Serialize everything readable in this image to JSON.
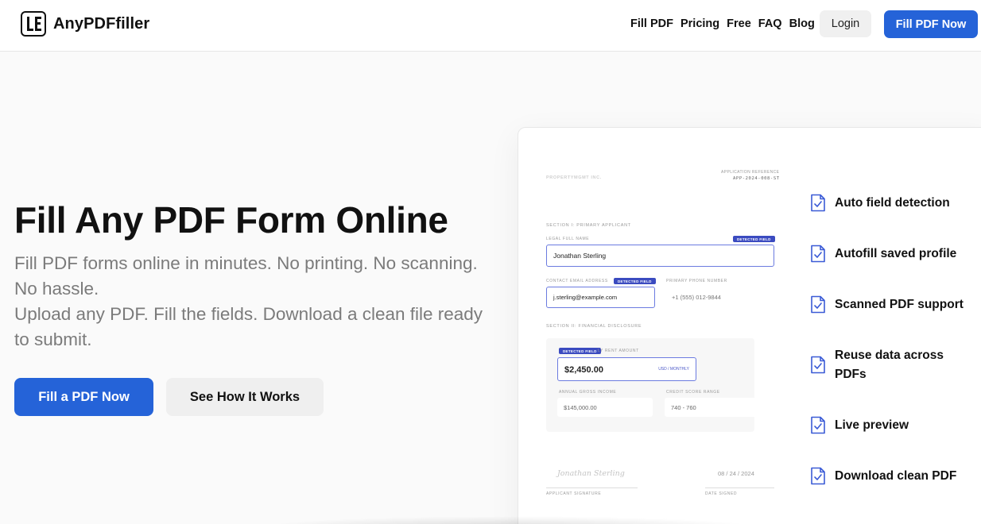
{
  "header": {
    "brand": "AnyPDFfiller",
    "nav": [
      "Fill PDF",
      "Pricing",
      "Free",
      "FAQ",
      "Blog"
    ],
    "login": "Login",
    "cta": "Fill PDF Now"
  },
  "hero": {
    "title": "Fill Any PDF Form Online",
    "subtitle_line1": "Fill PDF forms online in minutes. No printing. No scanning. No hassle.",
    "subtitle_line2": "Upload any PDF. Fill the fields. Download a clean file ready to submit.",
    "primary_button": "Fill a PDF Now",
    "secondary_button": "See How It Works"
  },
  "preview": {
    "brand": "PROPERTYMGMT INC.",
    "reference_label": "APPLICATION REFERENCE",
    "reference": "APP-2024-008-ST",
    "section1": "SECTION I: PRIMARY APPLICANT",
    "legal_name_label": "LEGAL FULL NAME",
    "detected_tag": "DETECTED FIELD",
    "legal_name": "Jonathan Sterling",
    "email_label": "CONTACT EMAIL ADDRESS",
    "email": "j.sterling@example.com",
    "phone_label": "PRIMARY PHONE NUMBER",
    "phone": "+1 (555) 012-9844",
    "section2": "SECTION II: FINANCIAL DISCLOSURE",
    "rent_label": "LY RENT AMOUNT",
    "rent": "$2,450.00",
    "rent_unit": "USD / MONTHLY",
    "income_label": "ANNUAL GROSS INCOME",
    "income": "$145,000.00",
    "credit_label": "CREDIT SCORE RANGE",
    "credit": "740 - 760",
    "signature": "Jonathan Sterling",
    "signature_label": "APPLICANT SIGNATURE",
    "date": "08 / 24 / 2024",
    "date_label": "DATE SIGNED"
  },
  "features": [
    "Auto field detection",
    "Autofill saved profile",
    "Scanned PDF support",
    "Reuse data across PDFs",
    "Live preview",
    "Download clean PDF"
  ],
  "colors": {
    "accent": "#2563d8",
    "tag": "#3b4bc0",
    "icon": "#3b5bd6"
  }
}
